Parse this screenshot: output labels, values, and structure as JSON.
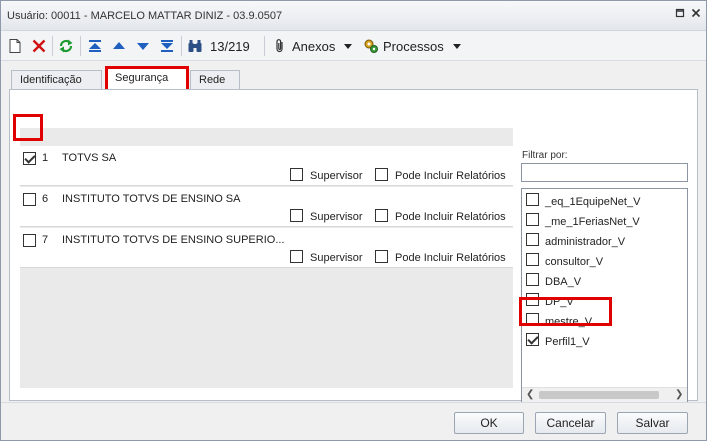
{
  "window": {
    "title": "Usuário: 00011 - MARCELO MATTAR DINIZ - 03.9.0507",
    "controls": [
      "restore-icon",
      "close-icon"
    ]
  },
  "toolbar": {
    "icons": [
      "new-icon",
      "delete-icon",
      "refresh-icon",
      "first-record-icon",
      "previous-record-icon",
      "next-record-icon",
      "last-record-icon",
      "binoculars-icon"
    ],
    "record_position": "13/219",
    "anexos_label": "Anexos",
    "processos_label": "Processos"
  },
  "tabs": [
    {
      "label": "Identificação",
      "active": false
    },
    {
      "label": "Segurança",
      "active": true
    },
    {
      "label": "Rede",
      "active": false
    }
  ],
  "companies": [
    {
      "checked": true,
      "code": "1",
      "name": "TOTVS SA",
      "supervisor_label": "Supervisor",
      "supervisor_checked": false,
      "reports_label": "Pode Incluir Relatórios",
      "reports_checked": false
    },
    {
      "checked": false,
      "code": "6",
      "name": "INSTITUTO TOTVS DE ENSINO SA",
      "supervisor_label": "Supervisor",
      "supervisor_checked": false,
      "reports_label": "Pode Incluir Relatórios",
      "reports_checked": false
    },
    {
      "checked": false,
      "code": "7",
      "name": "INSTITUTO TOTVS DE ENSINO SUPERIO...",
      "supervisor_label": "Supervisor",
      "supervisor_checked": false,
      "reports_label": "Pode Incluir Relatórios",
      "reports_checked": false
    }
  ],
  "filter": {
    "label": "Filtrar por:",
    "value": "",
    "items": [
      {
        "label": "_eq_1EquipeNet_V",
        "checked": false
      },
      {
        "label": "_me_1FeriasNet_V",
        "checked": false
      },
      {
        "label": "administrador_V",
        "checked": false
      },
      {
        "label": "consultor_V",
        "checked": false
      },
      {
        "label": "DBA_V",
        "checked": false
      },
      {
        "label": "DP_V",
        "checked": false
      },
      {
        "label": "mestre_V",
        "checked": false
      },
      {
        "label": "Perfil1_V",
        "checked": true
      }
    ]
  },
  "buttons": {
    "ok": "OK",
    "cancel": "Cancelar",
    "save": "Salvar"
  },
  "colors": {
    "highlight": "#e00000",
    "toolbar_blue": "#1f5fbf",
    "delete_red": "#d01010",
    "refresh_green": "#1e9a2e"
  }
}
